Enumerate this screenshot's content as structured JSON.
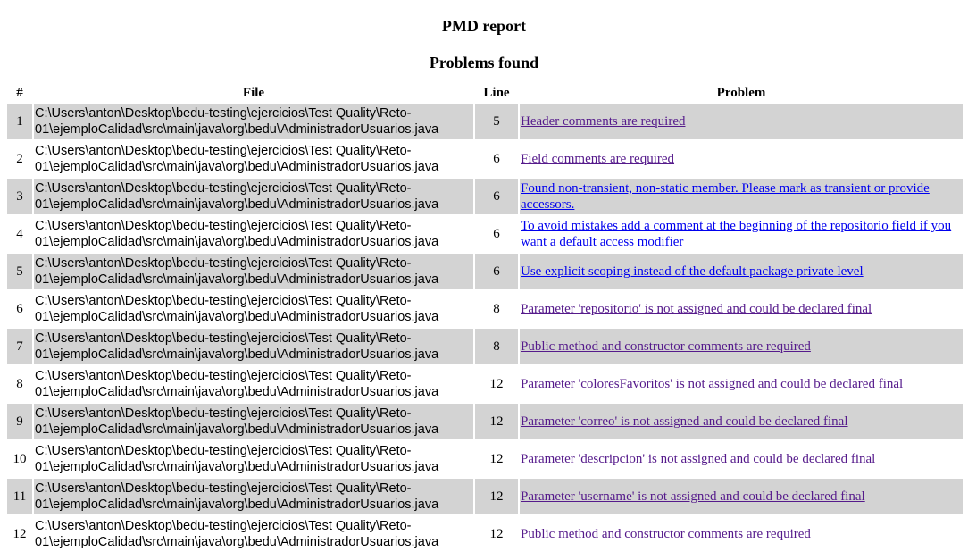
{
  "report_title": "PMD report",
  "section_title": "Problems found",
  "columns": {
    "num": "#",
    "file": "File",
    "line": "Line",
    "problem": "Problem"
  },
  "colors": {
    "stripe": "#d3d3d3",
    "link_visited": "#551a8b",
    "link_unvisited": "#0000ee"
  },
  "rows": [
    {
      "num": "1",
      "file": "C:\\Users\\anton\\Desktop\\bedu-testing\\ejercicios\\Test Quality\\Reto-01\\ejemploCalidad\\src\\main\\java\\org\\bedu\\AdministradorUsuarios.java",
      "line": "5",
      "problem": "Header comments are required",
      "visited": true
    },
    {
      "num": "2",
      "file": "C:\\Users\\anton\\Desktop\\bedu-testing\\ejercicios\\Test Quality\\Reto-01\\ejemploCalidad\\src\\main\\java\\org\\bedu\\AdministradorUsuarios.java",
      "line": "6",
      "problem": "Field comments are required",
      "visited": true
    },
    {
      "num": "3",
      "file": "C:\\Users\\anton\\Desktop\\bedu-testing\\ejercicios\\Test Quality\\Reto-01\\ejemploCalidad\\src\\main\\java\\org\\bedu\\AdministradorUsuarios.java",
      "line": "6",
      "problem": "Found non-transient, non-static member. Please mark as transient or provide accessors.",
      "visited": false
    },
    {
      "num": "4",
      "file": "C:\\Users\\anton\\Desktop\\bedu-testing\\ejercicios\\Test Quality\\Reto-01\\ejemploCalidad\\src\\main\\java\\org\\bedu\\AdministradorUsuarios.java",
      "line": "6",
      "problem": "To avoid mistakes add a comment at the beginning of the repositorio field if you want a default access modifier",
      "visited": false
    },
    {
      "num": "5",
      "file": "C:\\Users\\anton\\Desktop\\bedu-testing\\ejercicios\\Test Quality\\Reto-01\\ejemploCalidad\\src\\main\\java\\org\\bedu\\AdministradorUsuarios.java",
      "line": "6",
      "problem": "Use explicit scoping instead of the default package private level",
      "visited": false
    },
    {
      "num": "6",
      "file": "C:\\Users\\anton\\Desktop\\bedu-testing\\ejercicios\\Test Quality\\Reto-01\\ejemploCalidad\\src\\main\\java\\org\\bedu\\AdministradorUsuarios.java",
      "line": "8",
      "problem": "Parameter 'repositorio' is not assigned and could be declared final",
      "visited": true
    },
    {
      "num": "7",
      "file": "C:\\Users\\anton\\Desktop\\bedu-testing\\ejercicios\\Test Quality\\Reto-01\\ejemploCalidad\\src\\main\\java\\org\\bedu\\AdministradorUsuarios.java",
      "line": "8",
      "problem": "Public method and constructor comments are required",
      "visited": true
    },
    {
      "num": "8",
      "file": "C:\\Users\\anton\\Desktop\\bedu-testing\\ejercicios\\Test Quality\\Reto-01\\ejemploCalidad\\src\\main\\java\\org\\bedu\\AdministradorUsuarios.java",
      "line": "12",
      "problem": "Parameter 'coloresFavoritos' is not assigned and could be declared final",
      "visited": true
    },
    {
      "num": "9",
      "file": "C:\\Users\\anton\\Desktop\\bedu-testing\\ejercicios\\Test Quality\\Reto-01\\ejemploCalidad\\src\\main\\java\\org\\bedu\\AdministradorUsuarios.java",
      "line": "12",
      "problem": "Parameter 'correo' is not assigned and could be declared final",
      "visited": true
    },
    {
      "num": "10",
      "file": "C:\\Users\\anton\\Desktop\\bedu-testing\\ejercicios\\Test Quality\\Reto-01\\ejemploCalidad\\src\\main\\java\\org\\bedu\\AdministradorUsuarios.java",
      "line": "12",
      "problem": "Parameter 'descripcion' is not assigned and could be declared final",
      "visited": true
    },
    {
      "num": "11",
      "file": "C:\\Users\\anton\\Desktop\\bedu-testing\\ejercicios\\Test Quality\\Reto-01\\ejemploCalidad\\src\\main\\java\\org\\bedu\\AdministradorUsuarios.java",
      "line": "12",
      "problem": "Parameter 'username' is not assigned and could be declared final",
      "visited": true
    },
    {
      "num": "12",
      "file": "C:\\Users\\anton\\Desktop\\bedu-testing\\ejercicios\\Test Quality\\Reto-01\\ejemploCalidad\\src\\main\\java\\org\\bedu\\AdministradorUsuarios.java",
      "line": "12",
      "problem": "Public method and constructor comments are required",
      "visited": true
    }
  ]
}
